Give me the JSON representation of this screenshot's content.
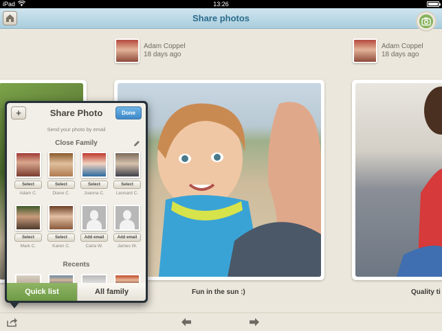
{
  "status_bar": {
    "carrier": "iPad",
    "time": "13:26"
  },
  "nav": {
    "title": "Share photos",
    "home_icon": "home-icon",
    "camera_icon": "camera-icon"
  },
  "posters": [
    {
      "name": "Adam Coppel",
      "ago": "18 days ago"
    },
    {
      "name": "Adam Coppel",
      "ago": "18 days ago"
    }
  ],
  "captions": {
    "main": "Fun in the sun :)",
    "right": "Quality ti"
  },
  "popover": {
    "add_label": "+",
    "title": "Share Photo",
    "done_label": "Done",
    "subtitle": "Send your photo by email",
    "section_family": "Close Family",
    "section_recents": "Recents",
    "contacts": [
      {
        "name": "Adam C.",
        "action": "Select"
      },
      {
        "name": "Diane C.",
        "action": "Select"
      },
      {
        "name": "Joanna C.",
        "action": "Select"
      },
      {
        "name": "Leonard C.",
        "action": "Select"
      },
      {
        "name": "Mark C.",
        "action": "Select"
      },
      {
        "name": "Karen C.",
        "action": "Select"
      },
      {
        "name": "Carla W.",
        "action": "Add email"
      },
      {
        "name": "James W.",
        "action": "Add email"
      }
    ],
    "tabs": {
      "quick": "Quick list",
      "all": "All family"
    }
  },
  "colors": {
    "accent_green": "#7aa650",
    "nav_blue": "#2b6c8c",
    "done_blue": "#3d88c8"
  }
}
